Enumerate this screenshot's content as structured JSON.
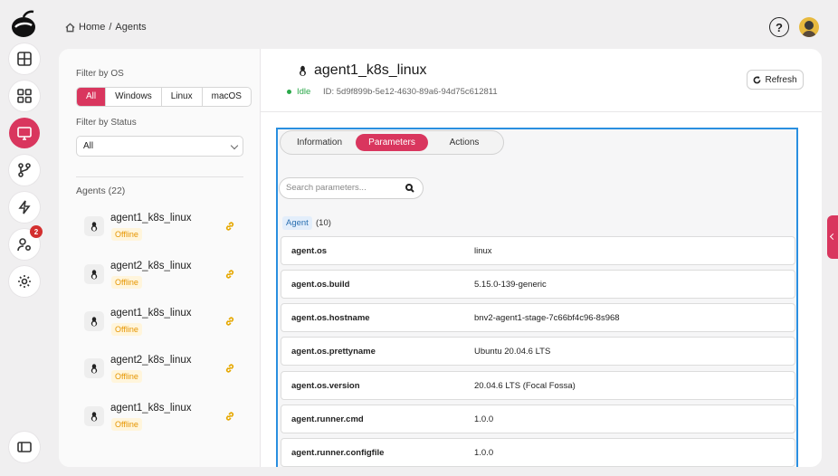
{
  "breadcrumb": {
    "home": "Home",
    "separator": "/",
    "current": "Agents"
  },
  "header": {
    "help_label": "?"
  },
  "rail": {
    "notification_count": "2"
  },
  "filters": {
    "os_label": "Filter by OS",
    "os_options": [
      "All",
      "Windows",
      "Linux",
      "macOS"
    ],
    "os_selected": "All",
    "status_label": "Filter by Status",
    "status_value": "All",
    "agents_heading": "Agents (22)"
  },
  "agents": [
    {
      "name": "agent1_k8s_linux",
      "status": "Offline"
    },
    {
      "name": "agent2_k8s_linux",
      "status": "Offline"
    },
    {
      "name": "agent1_k8s_linux",
      "status": "Offline"
    },
    {
      "name": "agent2_k8s_linux",
      "status": "Offline"
    },
    {
      "name": "agent1_k8s_linux",
      "status": "Offline"
    }
  ],
  "detail": {
    "title": "agent1_k8s_linux",
    "status": "Idle",
    "id_text": "ID: 5d9f899b-5e12-4630-89a6-94d75c612811",
    "refresh_label": "Refresh",
    "tabs": [
      "Information",
      "Parameters",
      "Actions"
    ],
    "active_tab": "Parameters",
    "search_placeholder": "Search parameters...",
    "group_tag": "Agent",
    "group_count": "(10)",
    "rows": [
      {
        "key": "agent.os",
        "value": "linux"
      },
      {
        "key": "agent.os.build",
        "value": "5.15.0-139-generic"
      },
      {
        "key": "agent.os.hostname",
        "value": "bnv2-agent1-stage-7c66bf4c96-8s968"
      },
      {
        "key": "agent.os.prettyname",
        "value": "Ubuntu 20.04.6 LTS"
      },
      {
        "key": "agent.os.version",
        "value": "20.04.6 LTS (Focal Fossa)"
      },
      {
        "key": "agent.runner.cmd",
        "value": "1.0.0"
      },
      {
        "key": "agent.runner.configfile",
        "value": "1.0.0"
      }
    ]
  },
  "colors": {
    "accent": "#d9365e",
    "idle": "#2aa84a",
    "offline": "#e69500",
    "highlight": "#2a8fe0"
  }
}
